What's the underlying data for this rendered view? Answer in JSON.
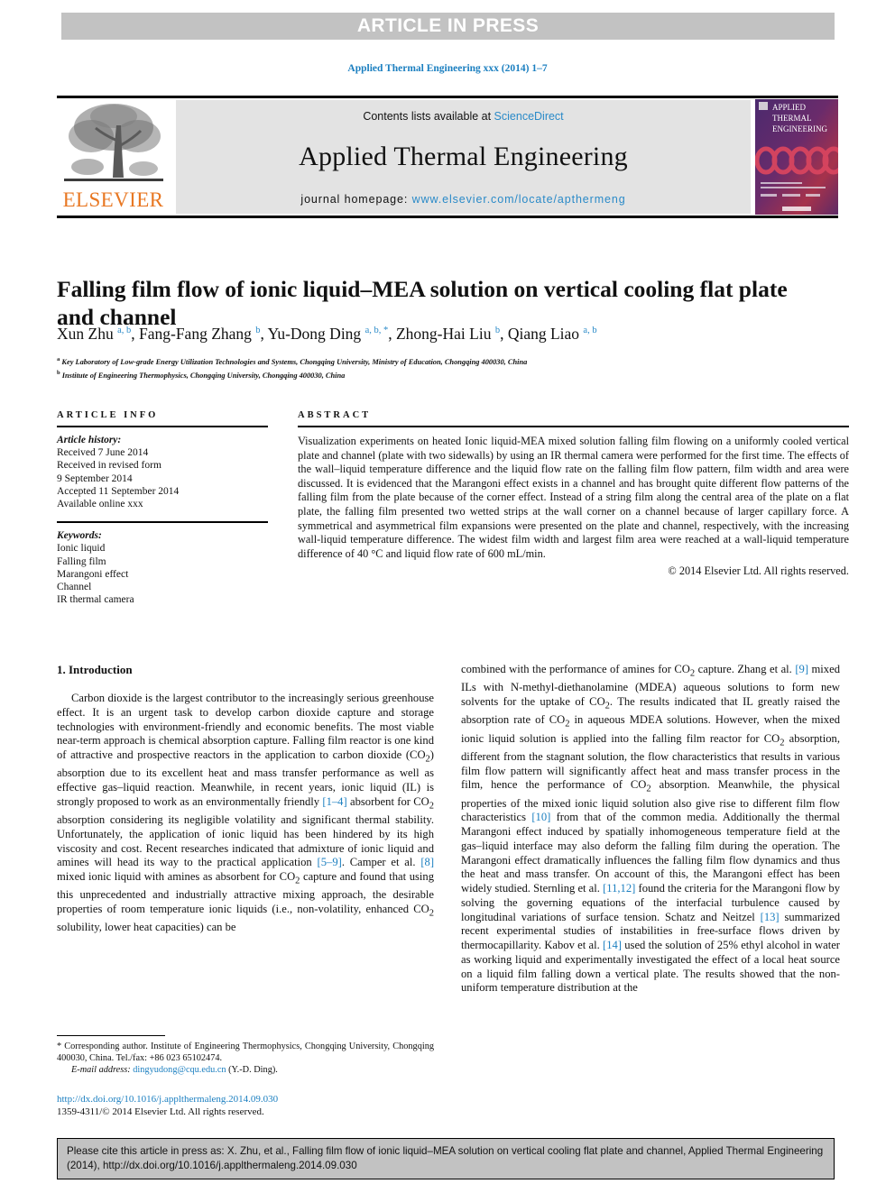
{
  "banner": {
    "label": "ARTICLE IN PRESS"
  },
  "running_head": "Applied Thermal Engineering xxx (2014) 1–7",
  "masthead": {
    "contents_prefix": "Contents lists available at ",
    "sciencedirect": "ScienceDirect",
    "journal_title": "Applied Thermal Engineering",
    "homepage_prefix": "journal homepage: ",
    "homepage_url": "www.elsevier.com/locate/apthermeng",
    "publisher": "ELSEVIER",
    "cover_title_line1": "APPLIED",
    "cover_title_line2": "THERMAL",
    "cover_title_line3": "ENGINEERING",
    "colors": {
      "banner_gray": "#c2c2c2",
      "link_blue": "#2a8ac8",
      "elsevier_orange": "#e87722",
      "masthead_gray": "#e3e3e3"
    }
  },
  "article": {
    "title": "Falling film flow of ionic liquid–MEA solution on vertical cooling flat plate and channel",
    "authors_html": "Xun Zhu <sup>a, b</sup>, Fang-Fang Zhang <sup>b</sup>, Yu-Dong Ding <sup>a, b, *</sup>, Zhong-Hai Liu <sup>b</sup>, Qiang Liao <sup>a, b</sup>",
    "affiliation_a": "Key Laboratory of Low-grade Energy Utilization Technologies and Systems, Chongqing University, Ministry of Education, Chongqing 400030, China",
    "affiliation_b": "Institute of Engineering Thermophysics, Chongqing University, Chongqing 400030, China"
  },
  "article_info": {
    "heading": "ARTICLE INFO",
    "history_label": "Article history:",
    "history": [
      "Received 7 June 2014",
      "Received in revised form",
      "9 September 2014",
      "Accepted 11 September 2014",
      "Available online xxx"
    ],
    "keywords_label": "Keywords:",
    "keywords": [
      "Ionic liquid",
      "Falling film",
      "Marangoni effect",
      "Channel",
      "IR thermal camera"
    ]
  },
  "abstract": {
    "heading": "ABSTRACT",
    "text": "Visualization experiments on heated Ionic liquid-MEA mixed solution falling film flowing on a uniformly cooled vertical plate and channel (plate with two sidewalls) by using an IR thermal camera were performed for the first time. The effects of the wall–liquid temperature difference and the liquid flow rate on the falling film flow pattern, film width and area were discussed. It is evidenced that the Marangoni effect exists in a channel and has brought quite different flow patterns of the falling film from the plate because of the corner effect. Instead of a string film along the central area of the plate on a flat plate, the falling film presented two wetted strips at the wall corner on a channel because of larger capillary force. A symmetrical and asymmetrical film expansions were presented on the plate and channel, respectively, with the increasing wall-liquid temperature difference. The widest film width and largest film area were reached at a wall-liquid temperature difference of 40 °C and liquid flow rate of 600 mL/min.",
    "copyright": "© 2014 Elsevier Ltd. All rights reserved."
  },
  "body": {
    "section_heading": "1. Introduction",
    "left_html": "Carbon dioxide is the largest contributor to the increasingly serious greenhouse effect. It is an urgent task to develop carbon dioxide capture and storage technologies with environment-friendly and economic benefits. The most viable near-term approach is chemical absorption capture. Falling film reactor is one kind of attractive and prospective reactors in the application to carbon dioxide (CO<sub>2</sub>) absorption due to its excellent heat and mass transfer performance as well as effective gas–liquid reaction. Meanwhile, in recent years, ionic liquid (IL) is strongly proposed to work as an environmentally friendly <span class=\"ref\">[1–4]</span> absorbent for CO<sub>2</sub> absorption considering its negligible volatility and significant thermal stability. Unfortunately, the application of ionic liquid has been hindered by its high viscosity and cost. Recent researches indicated that admixture of ionic liquid and amines will head its way to the practical application <span class=\"ref\">[5–9]</span>. Camper et al. <span class=\"ref\">[8]</span> mixed ionic liquid with amines as absorbent for CO<sub>2</sub> capture and found that using this unprecedented and industrially attractive mixing approach, the desirable properties of room temperature ionic liquids (i.e., non-volatility, enhanced CO<sub>2</sub> solubility, lower heat capacities) can be",
    "right_html": "combined with the performance of amines for CO<sub>2</sub> capture. Zhang et al. <span class=\"ref\">[9]</span> mixed ILs with N-methyl-diethanolamine (MDEA) aqueous solutions to form new solvents for the uptake of CO<sub>2</sub>. The results indicated that IL greatly raised the absorption rate of CO<sub>2</sub> in aqueous MDEA solutions. However, when the mixed ionic liquid solution is applied into the falling film reactor for CO<sub>2</sub> absorption, different from the stagnant solution, the flow characteristics that results in various film flow pattern will significantly affect heat and mass transfer process in the film, hence the performance of CO<sub>2</sub> absorption. Meanwhile, the physical properties of the mixed ionic liquid solution also give rise to different film flow characteristics <span class=\"ref\">[10]</span> from that of the common media. Additionally the thermal Marangoni effect induced by spatially inhomogeneous temperature field at the gas–liquid interface may also deform the falling film during the operation. The Marangoni effect dramatically influences the falling film flow dynamics and thus the heat and mass transfer. On account of this, the Marangoni effect has been widely studied. Sternling et al. <span class=\"ref\">[11,12]</span> found the criteria for the Marangoni flow by solving the governing equations of the interfacial turbulence caused by longitudinal variations of surface tension. Schatz and Neitzel <span class=\"ref\">[13]</span> summarized recent experimental studies of instabilities in free-surface flows driven by thermocapillarity. Kabov et al. <span class=\"ref\">[14]</span> used the solution of 25% ethyl alcohol in water as working liquid and experimentally investigated the effect of a local heat source on a liquid film falling down a vertical plate. The results showed that the non-uniform temperature distribution at the"
  },
  "footnote": {
    "corresponding_html": "* Corresponding author. Institute of Engineering Thermophysics, Chongqing University, Chongqing 400030, China. Tel./fax: +86 023 65102474.",
    "email_label": "E-mail address:",
    "email": "dingyudong@cqu.edu.cn",
    "email_owner": "(Y.-D. Ding).",
    "doi_url": "http://dx.doi.org/10.1016/j.applthermaleng.2014.09.030",
    "issn_line": "1359-4311/© 2014 Elsevier Ltd. All rights reserved."
  },
  "cite_box": {
    "text": "Please cite this article in press as: X. Zhu, et al., Falling film flow of ionic liquid–MEA solution on vertical cooling flat plate and channel, Applied Thermal Engineering (2014), http://dx.doi.org/10.1016/j.applthermaleng.2014.09.030"
  }
}
